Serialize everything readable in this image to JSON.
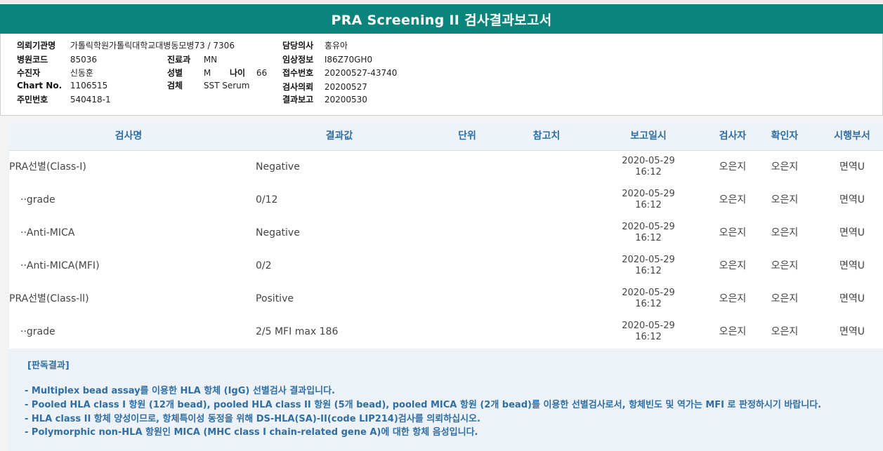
{
  "report": {
    "title": "PRA Screening II 검사결과보고서"
  },
  "info": {
    "institution_label": "의뢰기관명",
    "institution_value": "가톨릭학원가톨릭대학교대병동모병73 / 7306",
    "hospital_code_label": "병원코드",
    "hospital_code_value": "85036",
    "examinee_label": "수진자",
    "examinee_value": "신동훈",
    "chart_label": "Chart No.",
    "chart_value": "1106515",
    "resident_label": "주민번호",
    "resident_value": "540418-1",
    "dept_label": "진료과",
    "dept_value": "MN",
    "sex_label": "성별",
    "sex_value": "M",
    "age_label": "나이",
    "age_value": "66",
    "specimen_label": "검체",
    "specimen_value": "SST Serum",
    "doctor_label": "담당의사",
    "doctor_value": "홍유아",
    "clinical_label": "임상정보",
    "clinical_value": "I86Z70GH0",
    "receipt_label": "접수번호",
    "receipt_value": "20200527-43740",
    "request_label": "검사의뢰",
    "request_value": "20200527",
    "result_label": "결과보고",
    "result_value": "20200530"
  },
  "table": {
    "headers": {
      "test_name": "검사명",
      "result": "결과값",
      "unit": "단위",
      "reference": "참고치",
      "report_date": "보고일시",
      "tester": "검사자",
      "verifier": "확인자",
      "dept": "시행부서"
    },
    "rows": [
      {
        "name": "PRA선별(Class-I)",
        "result": "Negative",
        "unit": "",
        "reference": "",
        "date": "2020-05-29",
        "time": "16:12",
        "tester": "오은지",
        "verifier": "오은지",
        "dept": "면역U"
      },
      {
        "name": "··grade",
        "result": "0/12",
        "unit": "",
        "reference": "",
        "date": "2020-05-29",
        "time": "16:12",
        "tester": "오은지",
        "verifier": "오은지",
        "dept": "면역U"
      },
      {
        "name": "··Anti-MICA",
        "result": "Negative",
        "unit": "",
        "reference": "",
        "date": "2020-05-29",
        "time": "16:12",
        "tester": "오은지",
        "verifier": "오은지",
        "dept": "면역U"
      },
      {
        "name": "··Anti-MICA(MFI)",
        "result": "0/2",
        "unit": "",
        "reference": "",
        "date": "2020-05-29",
        "time": "16:12",
        "tester": "오은지",
        "verifier": "오은지",
        "dept": "면역U"
      },
      {
        "name": "PRA선별(Class-ll)",
        "result": "Positive",
        "unit": "",
        "reference": "",
        "date": "2020-05-29",
        "time": "16:12",
        "tester": "오은지",
        "verifier": "오은지",
        "dept": "면역U"
      },
      {
        "name": "··grade",
        "result": "2/5 MFI max 186",
        "unit": "",
        "reference": "",
        "date": "2020-05-29",
        "time": "16:12",
        "tester": "오은지",
        "verifier": "오은지",
        "dept": "면역U"
      }
    ]
  },
  "interpretation": {
    "title": "[판독결과]",
    "lines": [
      "- Multiplex bead assay를 이용한 HLA 항체 (IgG) 선별검사 결과입니다.",
      "- Pooled HLA class I 항원 (12개 bead), pooled HLA class II 항원 (5개 bead), pooled MICA 항원 (2개 bead)를 이용한 선별검사로서, 항체빈도 및 역가는 MFI 로 판정하시기 바랍니다.",
      "- HLA class II 항체 양성이므로, 항체특이성 동정을 위해 DS-HLA(SA)-II(code LIP214)검사를 의뢰하십시오.",
      "- Polymorphic non-HLA 항원인 MICA (MHC class I chain-related gene A)에 대한 항체 음성입니다."
    ]
  },
  "colors": {
    "title_bar": "#0b857b",
    "accent_text": "#2f6ea3",
    "header_bg": "#eef3f9"
  }
}
